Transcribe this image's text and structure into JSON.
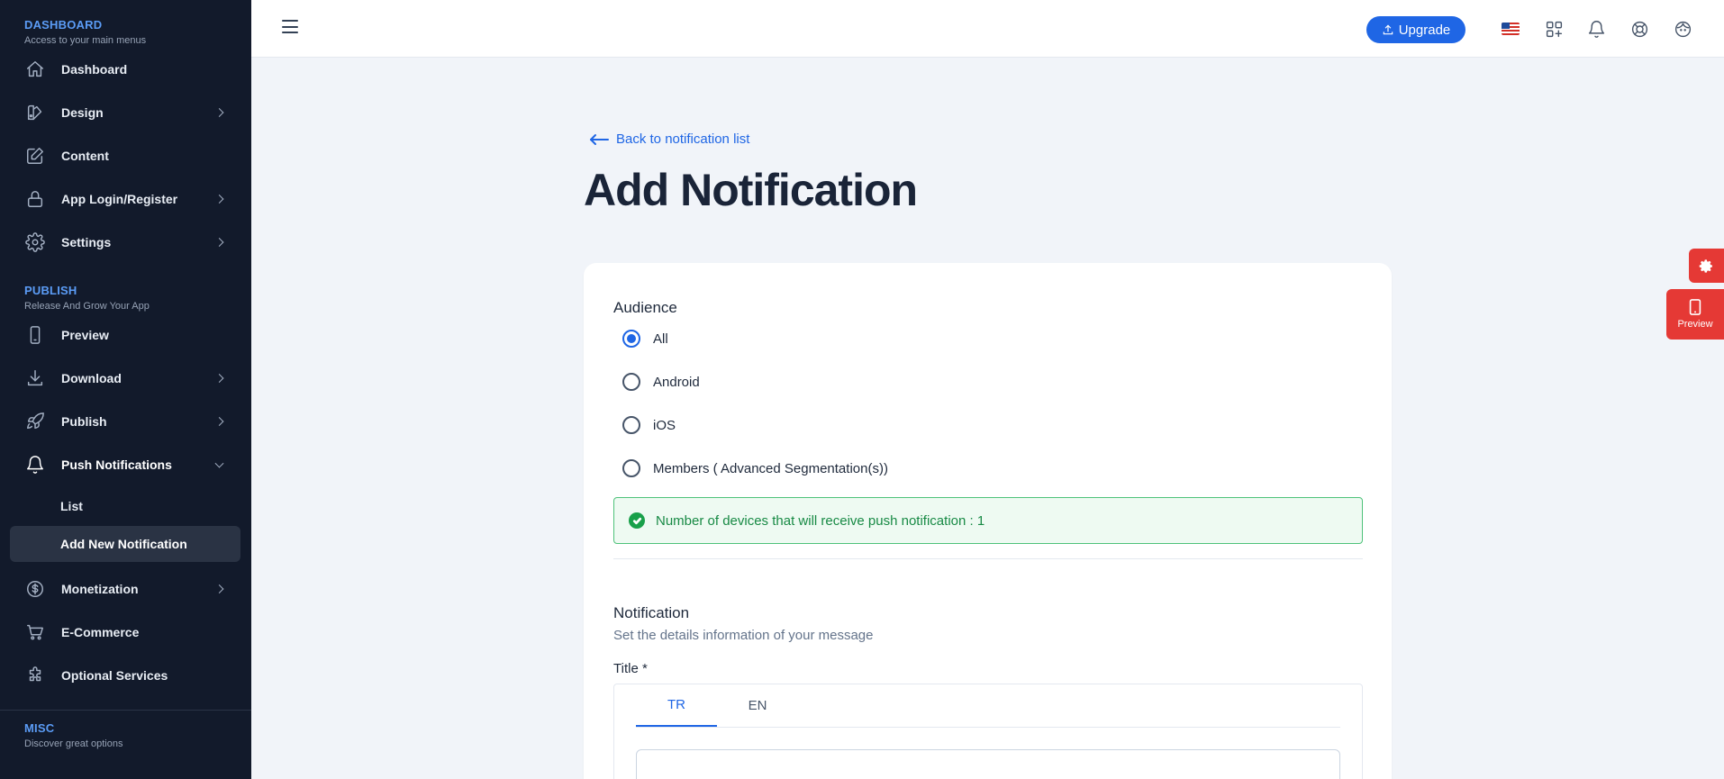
{
  "sidebar": {
    "sections": [
      {
        "title": "DASHBOARD",
        "subtitle": "Access to your main menus"
      },
      {
        "title": "PUBLISH",
        "subtitle": "Release And Grow Your App"
      },
      {
        "title": "MISC",
        "subtitle": "Discover great options"
      }
    ],
    "items": [
      {
        "label": "Dashboard",
        "icon": "home-icon"
      },
      {
        "label": "Design",
        "icon": "palette-icon"
      },
      {
        "label": "Content",
        "icon": "edit-icon"
      },
      {
        "label": "App Login/Register",
        "icon": "lock-icon"
      },
      {
        "label": "Settings",
        "icon": "gear-icon"
      },
      {
        "label": "Preview",
        "icon": "phone-icon"
      },
      {
        "label": "Download",
        "icon": "download-icon"
      },
      {
        "label": "Publish",
        "icon": "rocket-icon"
      },
      {
        "label": "Push Notifications",
        "icon": "bell-icon"
      },
      {
        "label": "Monetization",
        "icon": "dollar-icon"
      },
      {
        "label": "E-Commerce",
        "icon": "cart-icon"
      },
      {
        "label": "Optional Services",
        "icon": "puzzle-icon"
      }
    ],
    "sub_items": [
      {
        "label": "List"
      },
      {
        "label": "Add New Notification"
      }
    ]
  },
  "topbar": {
    "upgrade_label": "Upgrade",
    "icons": [
      "menu-icon",
      "us-flag-icon",
      "apps-icon",
      "bell-icon",
      "support-icon",
      "avatar-icon"
    ]
  },
  "main": {
    "back_link": "Back to notification list",
    "page_title": "Add Notification",
    "audience": {
      "label": "Audience",
      "options": [
        "All",
        "Android",
        "iOS",
        "Members ( Advanced Segmentation(s))"
      ],
      "selected": "All"
    },
    "alert_text": "Number of devices that will receive push notification : 1",
    "notification": {
      "heading": "Notification",
      "subheading": "Set the details information of your message",
      "title_label": "Title *",
      "tabs": [
        "TR",
        "EN"
      ],
      "active_tab": "TR",
      "title_value": ""
    }
  },
  "floating": {
    "preview_label": "Preview"
  },
  "colors": {
    "accent": "#1f66e5",
    "sidebar_bg": "#121a2b",
    "danger": "#e53935",
    "success": "#18a04a"
  }
}
